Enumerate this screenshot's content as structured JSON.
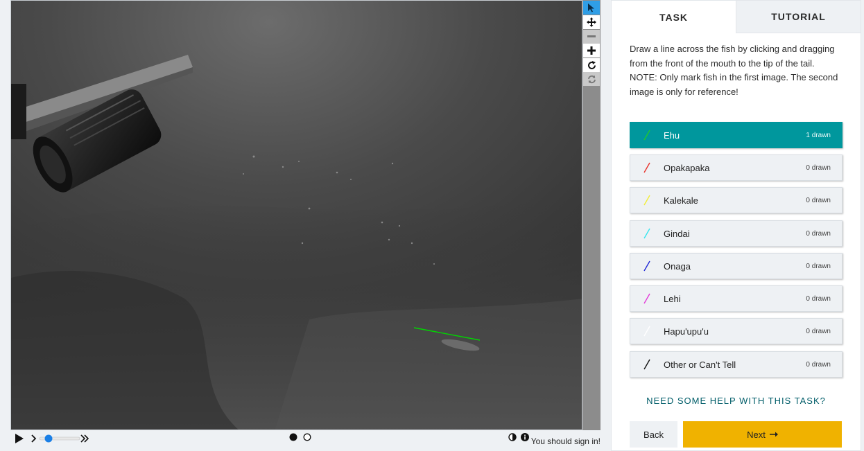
{
  "viewer": {
    "drawn_mark_color": "#00d600",
    "signin_text": "You should sign in!",
    "tools": [
      {
        "name": "pointer-icon",
        "state": "active"
      },
      {
        "name": "move-icon",
        "state": "normal"
      },
      {
        "name": "zoom-out-icon",
        "state": "disabled"
      },
      {
        "name": "zoom-in-icon",
        "state": "normal"
      },
      {
        "name": "rotate-icon",
        "state": "normal"
      },
      {
        "name": "reset-icon",
        "state": "disabled"
      }
    ],
    "frames": {
      "total": 2,
      "current": 1
    }
  },
  "tabs": {
    "task": "TASK",
    "tutorial": "TUTORIAL"
  },
  "instructions": {
    "line1": "Draw a line across the fish by clicking and dragging from the front of the mouth to the tip of the tail.",
    "line2": "NOTE: Only mark fish in the first image. The second image is only for reference!"
  },
  "choices": [
    {
      "label": "Ehu",
      "count": "1 drawn",
      "color": "#22c92a",
      "selected": true
    },
    {
      "label": "Opakapaka",
      "count": "0 drawn",
      "color": "#e8322b",
      "selected": false
    },
    {
      "label": "Kalekale",
      "count": "0 drawn",
      "color": "#f2ee35",
      "selected": false
    },
    {
      "label": "Gindai",
      "count": "0 drawn",
      "color": "#36e6ee",
      "selected": false
    },
    {
      "label": "Onaga",
      "count": "0 drawn",
      "color": "#1f27d6",
      "selected": false
    },
    {
      "label": "Lehi",
      "count": "0 drawn",
      "color": "#e23ad8",
      "selected": false
    },
    {
      "label": "Hapu'upu'u",
      "count": "0 drawn",
      "color": "#ffffff",
      "selected": false
    },
    {
      "label": "Other or Can't Tell",
      "count": "0 drawn",
      "color": "#111111",
      "selected": false
    }
  ],
  "help_text": "NEED SOME HELP WITH THIS TASK?",
  "buttons": {
    "back": "Back",
    "next": "Next"
  }
}
